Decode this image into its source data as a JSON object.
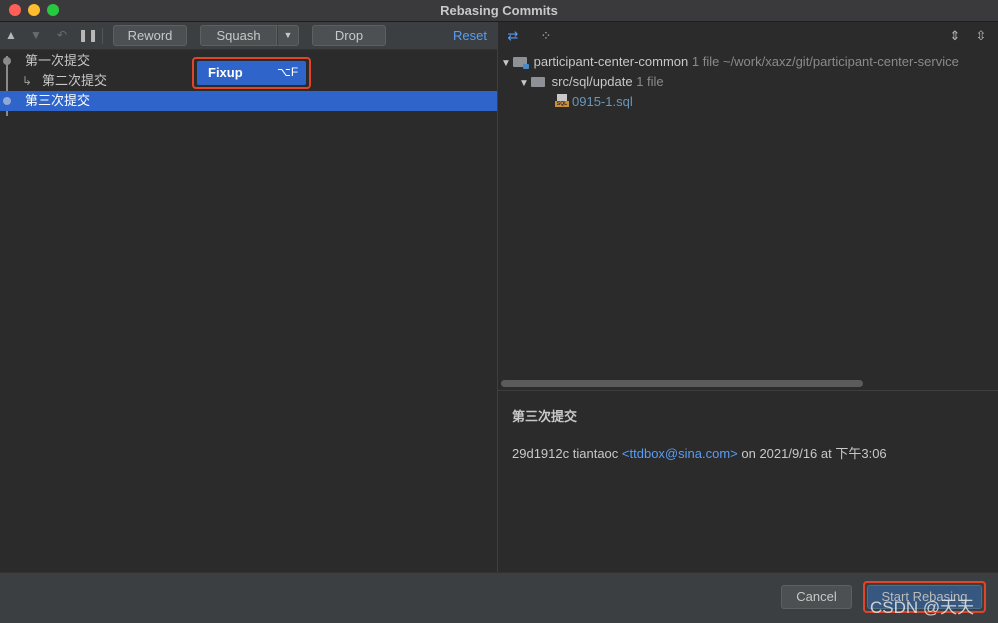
{
  "window": {
    "title": "Rebasing Commits"
  },
  "toolbar": {
    "move_up_icon": "triangle-up-icon",
    "move_down_icon": "triangle-down-icon",
    "undo_icon": "undo-icon",
    "pause_icon": "pause-icon",
    "reword_label": "Reword",
    "squash_label": "Squash",
    "drop_label": "Drop",
    "reset_label": "Reset"
  },
  "commits": [
    {
      "subject": "第一次提交",
      "fixup": false,
      "selected": false
    },
    {
      "subject": "第二次提交",
      "fixup": true,
      "selected": false
    },
    {
      "subject": "第三次提交",
      "fixup": false,
      "selected": true
    }
  ],
  "popup": {
    "label": "Fixup",
    "shortcut": "⌥F"
  },
  "changes_tree": {
    "root": {
      "name": "participant-center-common",
      "count": "1 file",
      "path": "~/work/xaxz/git/participant-center-service"
    },
    "folder": {
      "name": "src/sql/update",
      "count": "1 file"
    },
    "file": {
      "name": "0915-1.sql",
      "icon_tag": "SQL"
    }
  },
  "details": {
    "subject": "第三次提交",
    "hash": "29d1912c",
    "author": "tiantaoc",
    "email": "<ttdbox@sina.com>",
    "date_text": "on 2021/9/16 at 下午3:06"
  },
  "buttons": {
    "cancel_label": "Cancel",
    "start_label": "Start Rebasing"
  },
  "watermark": "CSDN @天天",
  "colors": {
    "selection": "#2f65ca",
    "link": "#589df6",
    "highlight_outline": "#e0452c"
  }
}
